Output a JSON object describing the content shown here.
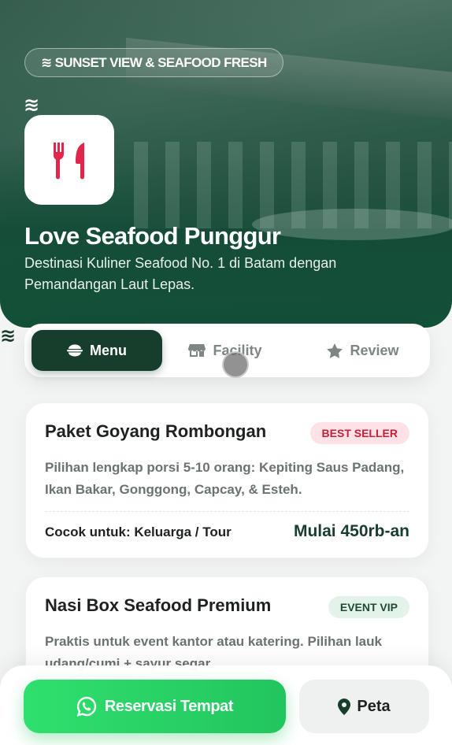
{
  "hero": {
    "tag": "SUNSET VIEW & SEAFOOD FRESH",
    "wave_glyph": "≋",
    "logo_icon": "utensils-icon",
    "title": "Love Seafood Punggur",
    "subtitle": "Destinasi Kuliner Seafood No. 1 di Batam dengan Pemandangan Laut Lepas."
  },
  "tabs": [
    {
      "label": "Menu",
      "icon": "bowl-icon",
      "active": true
    },
    {
      "label": "Facility",
      "icon": "store-icon",
      "active": false
    },
    {
      "label": "Review",
      "icon": "star-icon",
      "active": false
    }
  ],
  "menu_items": [
    {
      "name": "Paket Goyang Rombongan",
      "badge": "BEST SELLER",
      "description": "Pilihan lengkap porsi 5-10 orang: Kepiting Saus Padang, Ikan Bakar, Gonggong, Capcay, & Esteh.",
      "suitable_for": "Cocok untuk: Keluarga / Tour",
      "price": "Mulai 450rb-an"
    },
    {
      "name": "Nasi Box Seafood Premium",
      "badge": "EVENT VIP",
      "description": "Praktis untuk event kantor atau katering. Pilihan lauk udang/cumi + sayur segar."
    }
  ],
  "actions": {
    "reserve_label": "Reservasi Tempat",
    "map_label": "Peta"
  },
  "colors": {
    "brand_dark": "#173d2c",
    "accent_green": "#22c55e",
    "accent_red": "#e0264a"
  }
}
